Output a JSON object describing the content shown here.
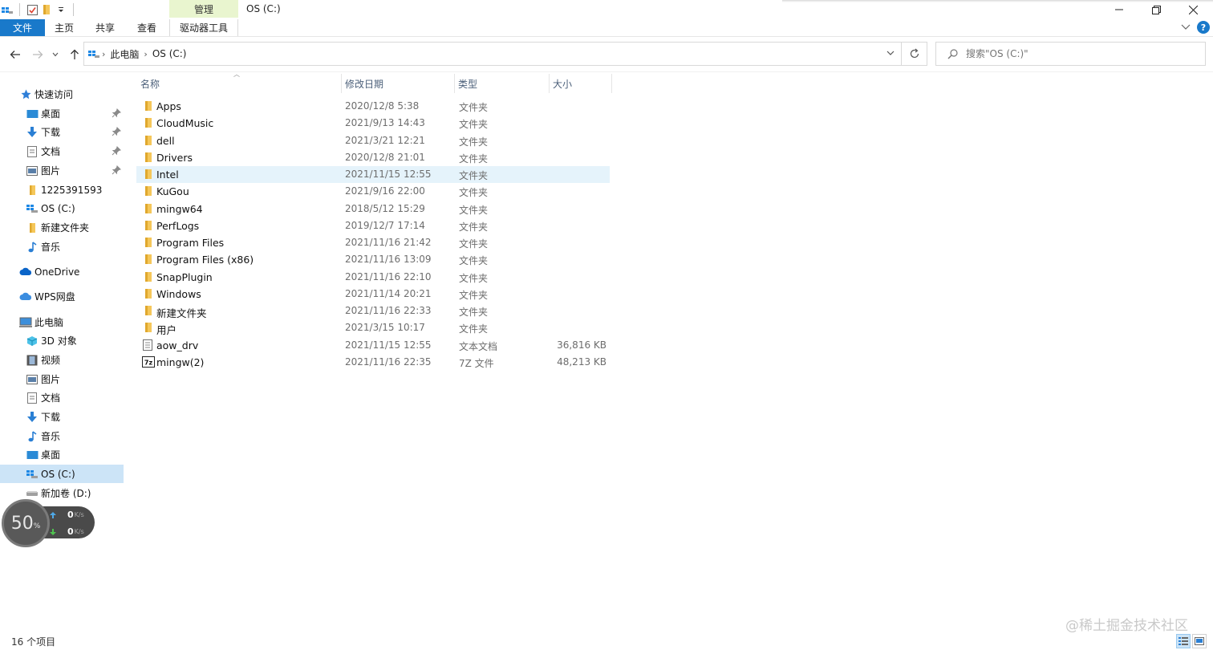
{
  "window": {
    "title": "OS (C:)",
    "contextual_tab_group": "管理",
    "controls": {
      "minimize": "—",
      "restore": "❐",
      "close": "✕"
    }
  },
  "ribbon": {
    "tabs": [
      "文件",
      "主页",
      "共享",
      "查看",
      "驱动器工具"
    ],
    "help_icon": "?"
  },
  "address_bar": {
    "crumbs": [
      "此电脑",
      "OS (C:)"
    ],
    "search_placeholder": "搜索\"OS (C:)\""
  },
  "nav_pane": {
    "quick_access": "快速访问",
    "quick_items": [
      "桌面",
      "下载",
      "文档",
      "图片",
      "1225391593",
      "OS (C:)",
      "新建文件夹",
      "音乐"
    ],
    "onedrive": "OneDrive",
    "wps": "WPS网盘",
    "this_pc": "此电脑",
    "pc_items": [
      "3D 对象",
      "视频",
      "图片",
      "文档",
      "下载",
      "音乐",
      "桌面",
      "OS (C:)",
      "新加卷 (D:)"
    ]
  },
  "columns": [
    "名称",
    "修改日期",
    "类型",
    "大小"
  ],
  "files": [
    {
      "name": "Apps",
      "date": "2020/12/8 5:38",
      "type": "文件夹",
      "size": "",
      "icon": "folder-icon"
    },
    {
      "name": "CloudMusic",
      "date": "2021/9/13 14:43",
      "type": "文件夹",
      "size": "",
      "icon": "folder-icon"
    },
    {
      "name": "dell",
      "date": "2021/3/21 12:21",
      "type": "文件夹",
      "size": "",
      "icon": "folder-icon"
    },
    {
      "name": "Drivers",
      "date": "2020/12/8 21:01",
      "type": "文件夹",
      "size": "",
      "icon": "folder-icon"
    },
    {
      "name": "Intel",
      "date": "2021/11/15 12:55",
      "type": "文件夹",
      "size": "",
      "icon": "folder-icon"
    },
    {
      "name": "KuGou",
      "date": "2021/9/16 22:00",
      "type": "文件夹",
      "size": "",
      "icon": "folder-icon"
    },
    {
      "name": "mingw64",
      "date": "2018/5/12 15:29",
      "type": "文件夹",
      "size": "",
      "icon": "folder-icon"
    },
    {
      "name": "PerfLogs",
      "date": "2019/12/7 17:14",
      "type": "文件夹",
      "size": "",
      "icon": "folder-icon"
    },
    {
      "name": "Program Files",
      "date": "2021/11/16 21:42",
      "type": "文件夹",
      "size": "",
      "icon": "folder-icon"
    },
    {
      "name": "Program Files (x86)",
      "date": "2021/11/16 13:09",
      "type": "文件夹",
      "size": "",
      "icon": "folder-icon"
    },
    {
      "name": "SnapPlugin",
      "date": "2021/11/16 22:10",
      "type": "文件夹",
      "size": "",
      "icon": "folder-icon"
    },
    {
      "name": "Windows",
      "date": "2021/11/14 20:21",
      "type": "文件夹",
      "size": "",
      "icon": "folder-icon"
    },
    {
      "name": "新建文件夹",
      "date": "2021/11/16 22:33",
      "type": "文件夹",
      "size": "",
      "icon": "folder-icon"
    },
    {
      "name": "用户",
      "date": "2021/3/15 10:17",
      "type": "文件夹",
      "size": "",
      "icon": "folder-icon"
    },
    {
      "name": "aow_drv",
      "date": "2021/11/15 12:55",
      "type": "文本文档",
      "size": "36,816 KB",
      "icon": "text-file-icon"
    },
    {
      "name": "mingw(2)",
      "date": "2021/11/16 22:35",
      "type": "7Z 文件",
      "size": "48,213 KB",
      "icon": "7z-archive-icon"
    }
  ],
  "hovered_row": "Intel",
  "widget": {
    "percent": "50",
    "percent_sign": "%",
    "up": "0",
    "down": "0",
    "unit": "K/s"
  },
  "status": {
    "item_count": "16 个项目"
  },
  "watermark": "@稀土掘金技术社区",
  "colors": {
    "accent": "#1979ca",
    "selected": "#cce4f7",
    "hover": "#e5f3fb",
    "folder": "#f5c75a",
    "manage_tab": "#e9f5cf"
  }
}
